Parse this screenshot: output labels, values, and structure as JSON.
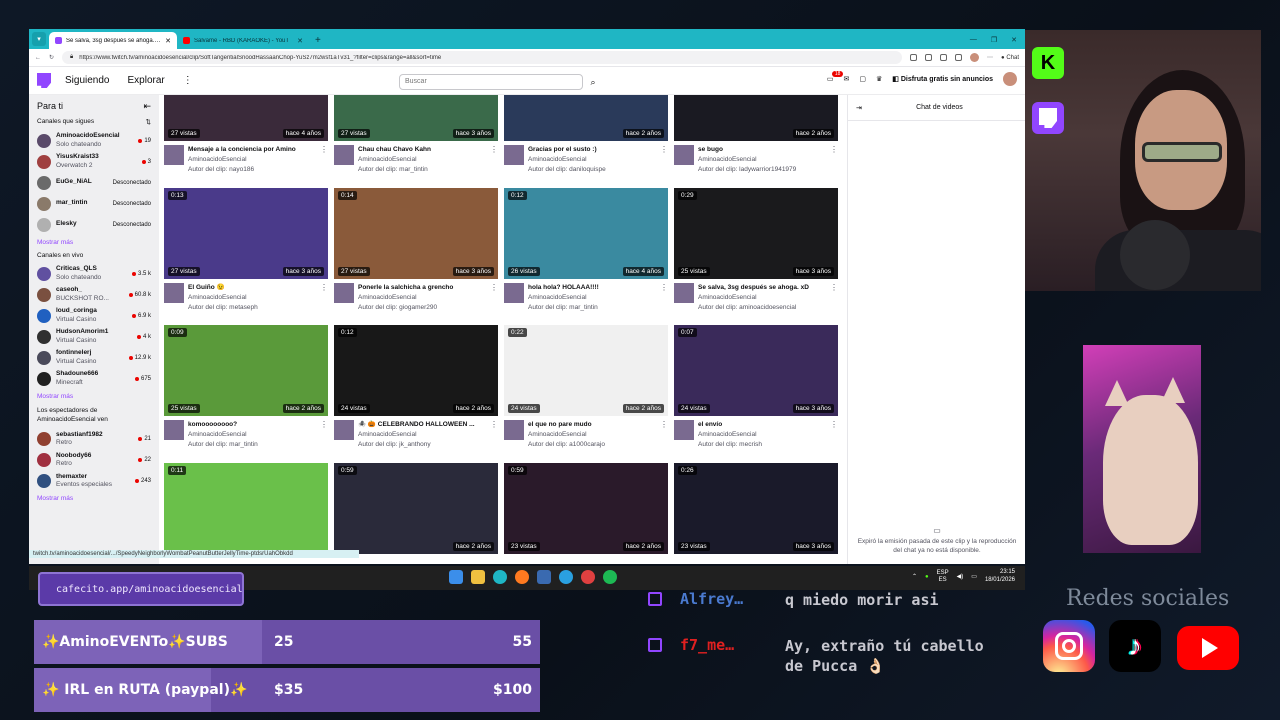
{
  "browser": {
    "tabs": [
      {
        "label": "Se salva, 3sg después se ahoga. xD",
        "active": true
      },
      {
        "label": "Salvame - RBD (KARAOKE) - YouT",
        "active": false
      }
    ],
    "url": "https://www.twitch.tv/aminoacidoesencial/clip/SoftTangentialSnoodHassaanChop-YuSz7m2wsf1aTv31_?filter=clips&range=all&sort=time",
    "status_url": "twitch.tv/aminoacidoesencial/.../SpeedyNeighborlyWombatPeanutButterJellyTime-ptdsrUahObkdd"
  },
  "twitch": {
    "nav": {
      "following": "Siguiendo",
      "browse": "Explorar",
      "more": "⋮"
    },
    "search_placeholder": "Buscar",
    "notifications": "18",
    "prime_label": "Disfruta gratis sin anuncios"
  },
  "sidebar": {
    "title": "Para ti",
    "followed_heading": "Canales que sigues",
    "followed": [
      {
        "name": "AminoacidoEsencial",
        "sub": "Solo chateando",
        "viewers": "19",
        "live": true,
        "color": "#5a4a6a"
      },
      {
        "name": "YisusKraist33",
        "sub": "Overwatch 2",
        "viewers": "3",
        "live": true,
        "color": "#a04040"
      },
      {
        "name": "EuGe_NiAL",
        "sub": "",
        "viewers": "Desconectado",
        "live": false,
        "color": "#6a6a6a"
      },
      {
        "name": "mar_tintin",
        "sub": "",
        "viewers": "Desconectado",
        "live": false,
        "color": "#8a7a6a"
      },
      {
        "name": "Elesky",
        "sub": "",
        "viewers": "Desconectado",
        "live": false,
        "color": "#b0b0b0"
      }
    ],
    "more1": "Mostrar más",
    "live_heading": "Canales en vivo",
    "live_channels": [
      {
        "name": "Criticas_QLS",
        "sub": "Solo chateando",
        "viewers": "3.5 k",
        "color": "#6050a0"
      },
      {
        "name": "caseoh_",
        "sub": "BUCKSHOT RO...",
        "viewers": "60.8 k",
        "color": "#7a5040"
      },
      {
        "name": "loud_coringa",
        "sub": "Virtual Casino",
        "viewers": "6.9 k",
        "color": "#2060c0"
      },
      {
        "name": "HudsonAmorim1",
        "sub": "Virtual Casino",
        "viewers": "4 k",
        "color": "#303030"
      },
      {
        "name": "fontinnelerj",
        "sub": "Virtual Casino",
        "viewers": "12.9 k",
        "color": "#4a4a5a"
      },
      {
        "name": "Shadoune666",
        "sub": "Minecraft",
        "viewers": "675",
        "color": "#202020"
      }
    ],
    "more2": "Mostrar más",
    "viewers_heading": "Los espectadores de AminoacidoEsencial ven",
    "viewer_channels": [
      {
        "name": "sebastianf1982",
        "sub": "Retro",
        "viewers": "21",
        "color": "#904030"
      },
      {
        "name": "Noobody66",
        "sub": "Retro",
        "viewers": "22",
        "color": "#a03040"
      },
      {
        "name": "themaxter",
        "sub": "Eventos especiales",
        "viewers": "243",
        "color": "#305080"
      }
    ],
    "more3": "Mostrar más"
  },
  "clips": [
    {
      "dur": "",
      "views": "27 vistas",
      "ago": "hace 4 años",
      "title": "Mensaje a la conciencia por Amino",
      "channel": "AminoacidoEsencial",
      "author": "Autor del clip: nayo186",
      "thumb": "#3a2a3a"
    },
    {
      "dur": "",
      "views": "27 vistas",
      "ago": "hace 3 años",
      "title": "Chau chau Chavo Kahn",
      "channel": "AminoacidoEsencial",
      "author": "Autor del clip: mar_tintin",
      "thumb": "#3a6a4a"
    },
    {
      "dur": "",
      "views": "",
      "ago": "hace 2 años",
      "title": "Gracias por el susto :)",
      "channel": "AminoacidoEsencial",
      "author": "Autor del clip: daniloquispe",
      "thumb": "#2a3a5a"
    },
    {
      "dur": "",
      "views": "",
      "ago": "hace 2 años",
      "title": "se bugo",
      "channel": "AminoacidoEsencial",
      "author": "Autor del clip: ladywarrior1941979",
      "thumb": "#1a1a22"
    },
    {
      "dur": "0:13",
      "views": "27 vistas",
      "ago": "hace 3 años",
      "title": "El Guiño 😉",
      "channel": "AminoacidoEsencial",
      "author": "Autor del clip: metaseph",
      "thumb": "#4a3a8a"
    },
    {
      "dur": "0:14",
      "views": "27 vistas",
      "ago": "hace 3 años",
      "title": "Ponerle la salchicha a grencho",
      "channel": "AminoacidoEsencial",
      "author": "Autor del clip: giogamer290",
      "thumb": "#8a5a3a"
    },
    {
      "dur": "0:12",
      "views": "26 vistas",
      "ago": "hace 4 años",
      "title": "hola hola? HOLAAA!!!!",
      "channel": "AminoacidoEsencial",
      "author": "Autor del clip: mar_tintin",
      "thumb": "#3a8aa0"
    },
    {
      "dur": "0:29",
      "views": "25 vistas",
      "ago": "hace 3 años",
      "title": "Se salva, 3sg después se ahoga. xD",
      "channel": "AminoacidoEsencial",
      "author": "Autor del clip: aminoacidoesencial",
      "thumb": "#1a1a1c"
    },
    {
      "dur": "0:09",
      "views": "25 vistas",
      "ago": "hace 2 años",
      "title": "komoooooooo?",
      "channel": "AminoacidoEsencial",
      "author": "Autor del clip: mar_tintin",
      "thumb": "#5a9a3a"
    },
    {
      "dur": "0:12",
      "views": "24 vistas",
      "ago": "hace 2 años",
      "title": "🕷️ 🎃 CELEBRANDO HALLOWEEN ...",
      "channel": "AminoacidoEsencial",
      "author": "Autor del clip: jk_anthony",
      "thumb": "#181818"
    },
    {
      "dur": "0:22",
      "views": "24 vistas",
      "ago": "hace 2 años",
      "title": "el que no pare mudo",
      "channel": "AminoacidoEsencial",
      "author": "Autor del clip: a1000carajo",
      "thumb": "#f0f0f0"
    },
    {
      "dur": "0:07",
      "views": "24 vistas",
      "ago": "hace 3 años",
      "title": "el envío",
      "channel": "AminoacidoEsencial",
      "author": "Autor del clip: mecrish",
      "thumb": "#3a2a5a"
    },
    {
      "dur": "0:11",
      "views": "",
      "ago": "",
      "title": "",
      "channel": "",
      "author": "",
      "thumb": "#6ac04a"
    },
    {
      "dur": "0:59",
      "views": "",
      "ago": "hace 2 años",
      "title": "",
      "channel": "",
      "author": "",
      "thumb": "#2a2a3a"
    },
    {
      "dur": "0:59",
      "views": "23 vistas",
      "ago": "hace 2 años",
      "title": "",
      "channel": "",
      "author": "",
      "thumb": "#2a1a2a"
    },
    {
      "dur": "0:26",
      "views": "23 vistas",
      "ago": "hace 3 años",
      "title": "",
      "channel": "",
      "author": "",
      "thumb": "#1a1a2a"
    }
  ],
  "chat_panel": {
    "title": "Chat de videos",
    "message": "Expiró la emisión pasada de este clip y la reproducción del chat ya no está disponible."
  },
  "taskbar": {
    "lang1": "ESP",
    "lang2": "ES",
    "time": "23:15",
    "date": "18/01/2026"
  },
  "overlay": {
    "cafecito": "cafecito.app/aminoacidoesencial",
    "goals": [
      {
        "label": "✨AminoEVENTo✨SUBS",
        "current": "25",
        "target": "55",
        "fraction": 0.45
      },
      {
        "label": "✨ IRL en RUTA (paypal)✨",
        "current": "$35",
        "target": "$100",
        "fraction": 0.35
      }
    ],
    "chat": [
      {
        "user": "Alfrey…",
        "user_color": "#4a7ad0",
        "text": "q miedo morir asi"
      },
      {
        "user": "f7_me…",
        "user_color": "#e02020",
        "text": "Ay, extraño tú cabello de Pucca 👌🏻"
      }
    ],
    "social_title": "Redes sociales",
    "kick_letter": "K"
  }
}
